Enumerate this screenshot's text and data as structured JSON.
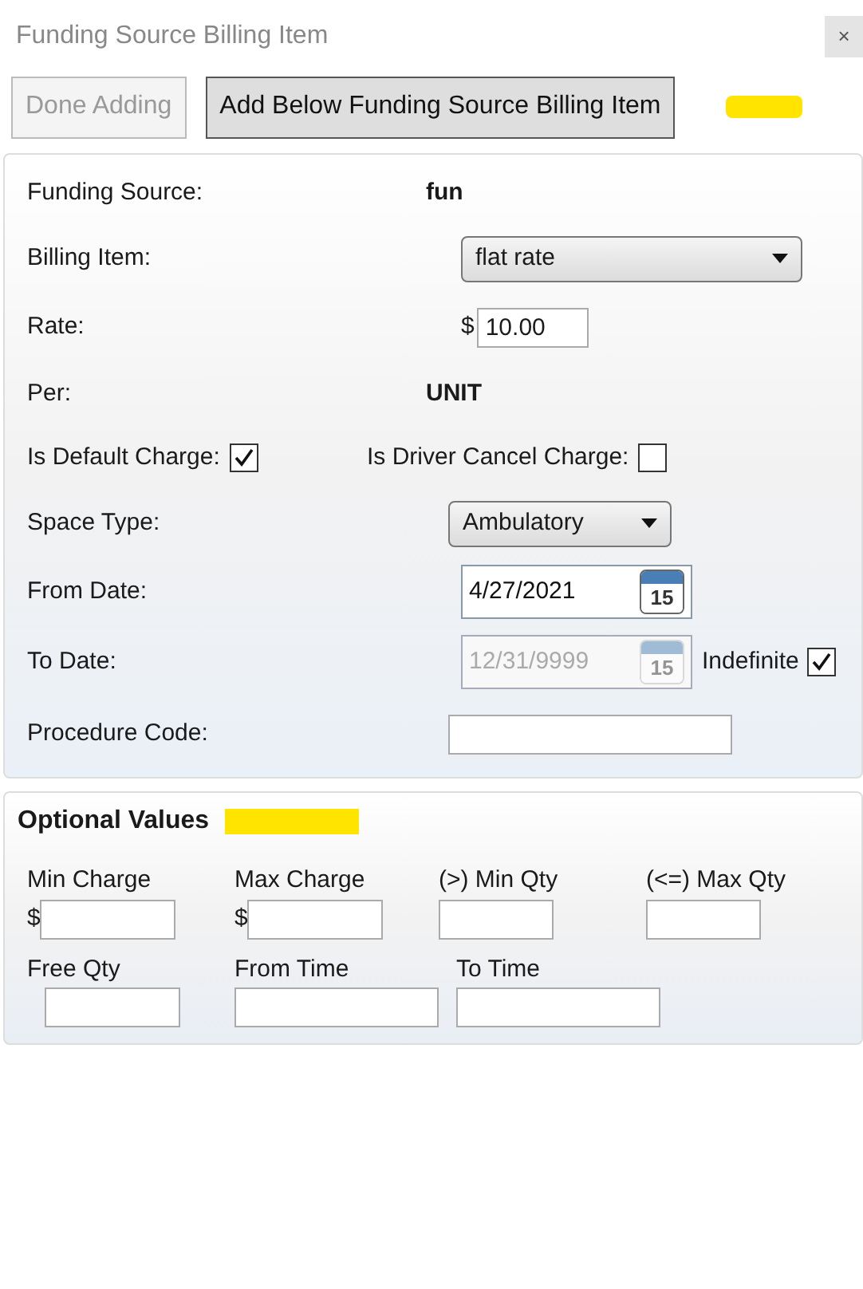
{
  "window": {
    "title": "Funding Source Billing Item",
    "close": "×"
  },
  "buttons": [
    {
      "label": "Done Adding",
      "disabled": true
    },
    {
      "label": "Add Below Funding Source Billing Item",
      "disabled": false
    }
  ],
  "details": {
    "fields": [
      {
        "kind": "text",
        "label": "Funding Source:",
        "value": "fun"
      },
      {
        "kind": "dropdown",
        "label": "Billing Item:",
        "value": "flat rate"
      },
      {
        "kind": "money",
        "label": "Rate:",
        "prefix": "$",
        "value": "10.00"
      },
      {
        "kind": "text",
        "label": "Per:",
        "value": "UNIT"
      },
      {
        "kind": "checks",
        "items": [
          {
            "label": "Is Default Charge:",
            "checked": true
          },
          {
            "label": "Is Driver Cancel Charge:",
            "checked": false
          }
        ]
      },
      {
        "kind": "dropdown",
        "label": "Space Type:",
        "value": "Ambulatory"
      },
      {
        "kind": "date",
        "label": "From Date:",
        "value": "4/27/2021",
        "disabled": false,
        "calendar_day": "15"
      },
      {
        "kind": "date",
        "label": "To Date:",
        "value": "12/31/9999",
        "disabled": true,
        "calendar_day": "15",
        "option": {
          "label": "Indefinite",
          "checked": true
        }
      },
      {
        "kind": "input",
        "label": "Procedure Code:"
      }
    ]
  },
  "optional_values": {
    "title": "Optional Values",
    "rows": [
      [
        {
          "label": "Min Charge",
          "prefix": "$"
        },
        {
          "label": "Max Charge",
          "prefix": "$"
        },
        {
          "label": "(>) Min Qty"
        },
        {
          "label": "(<=) Max Qty"
        }
      ],
      [
        {
          "label": "Free Qty"
        },
        {
          "label": "From Time"
        },
        {
          "label": "To Time"
        }
      ]
    ]
  }
}
